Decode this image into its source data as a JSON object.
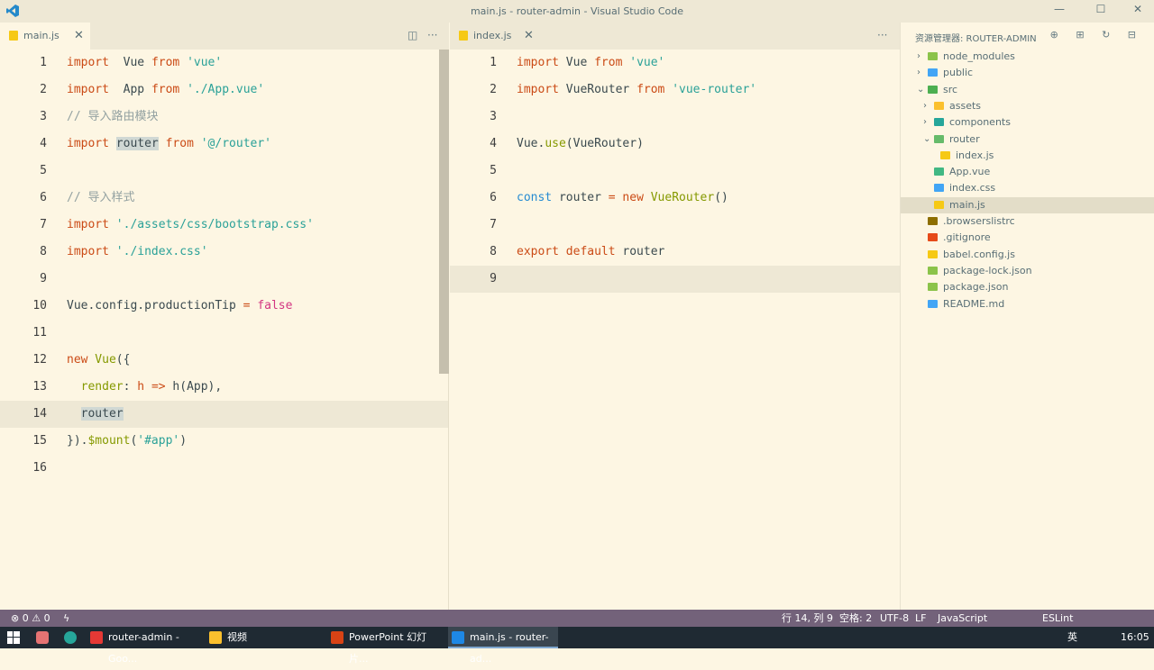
{
  "window": {
    "title": "main.js - router-admin - Visual Studio Code",
    "minimize": "—",
    "maximize": "☐",
    "close": "✕"
  },
  "left_tab": {
    "label": "main.js"
  },
  "right_tab": {
    "label": "index.js"
  },
  "left_code": [
    {
      "n": "1",
      "t": [
        [
          "kw",
          "import"
        ],
        [
          "",
          "  Vue "
        ],
        [
          "kw",
          "from"
        ],
        [
          "str",
          " 'vue'"
        ]
      ]
    },
    {
      "n": "2",
      "t": [
        [
          "kw",
          "import"
        ],
        [
          "",
          "  App "
        ],
        [
          "kw",
          "from"
        ],
        [
          "str",
          " './App.vue'"
        ]
      ]
    },
    {
      "n": "3",
      "t": [
        [
          "cmt",
          "// 导入路由模块"
        ]
      ]
    },
    {
      "n": "4",
      "t": [
        [
          "kw",
          "import"
        ],
        [
          "",
          " "
        ],
        [
          "sel",
          "router"
        ],
        [
          "",
          " "
        ],
        [
          "kw",
          "from"
        ],
        [
          "str",
          " '@/router'"
        ]
      ]
    },
    {
      "n": "5",
      "t": []
    },
    {
      "n": "6",
      "t": [
        [
          "cmt",
          "// 导入样式"
        ]
      ]
    },
    {
      "n": "7",
      "t": [
        [
          "kw",
          "import"
        ],
        [
          "str",
          " './assets/css/bootstrap.css'"
        ]
      ]
    },
    {
      "n": "8",
      "t": [
        [
          "kw",
          "import"
        ],
        [
          "str",
          " './index.css'"
        ]
      ]
    },
    {
      "n": "9",
      "t": []
    },
    {
      "n": "10",
      "t": [
        [
          "",
          "Vue.config.productionTip "
        ],
        [
          "kw",
          "="
        ],
        [
          "bool",
          " false"
        ]
      ]
    },
    {
      "n": "11",
      "t": []
    },
    {
      "n": "12",
      "t": [
        [
          "kw",
          "new"
        ],
        [
          "cls",
          " Vue"
        ],
        [
          "",
          "({"
        ]
      ]
    },
    {
      "n": "13",
      "t": [
        [
          "",
          "  "
        ],
        [
          "cls",
          "render"
        ],
        [
          "",
          ": "
        ],
        [
          "kw",
          "h"
        ],
        [
          "",
          " "
        ],
        [
          "kw",
          "=>"
        ],
        [
          "",
          " h(App),"
        ]
      ]
    },
    {
      "n": "14",
      "t": [
        [
          "",
          "  "
        ],
        [
          "sel",
          "router"
        ]
      ]
    },
    {
      "n": "15",
      "t": [
        [
          "",
          "})."
        ],
        [
          "cls",
          "$mount"
        ],
        [
          "",
          "("
        ],
        [
          "str",
          "'#app'"
        ],
        [
          "",
          ")"
        ]
      ]
    },
    {
      "n": "16",
      "t": []
    }
  ],
  "right_code": [
    {
      "n": "1",
      "t": [
        [
          "kw",
          "import"
        ],
        [
          "",
          " Vue "
        ],
        [
          "kw",
          "from"
        ],
        [
          "str",
          " 'vue'"
        ]
      ]
    },
    {
      "n": "2",
      "t": [
        [
          "kw",
          "import"
        ],
        [
          "",
          " VueRouter "
        ],
        [
          "kw",
          "from"
        ],
        [
          "str",
          " 'vue-router'"
        ]
      ]
    },
    {
      "n": "3",
      "t": []
    },
    {
      "n": "4",
      "t": [
        [
          "",
          "Vue."
        ],
        [
          "cls",
          "use"
        ],
        [
          "",
          "(VueRouter)"
        ]
      ]
    },
    {
      "n": "5",
      "t": []
    },
    {
      "n": "6",
      "t": [
        [
          "fn",
          "const"
        ],
        [
          "",
          " router "
        ],
        [
          "kw",
          "="
        ],
        [
          "kw",
          " new"
        ],
        [
          "cls",
          " VueRouter"
        ],
        [
          "",
          "()"
        ]
      ]
    },
    {
      "n": "7",
      "t": []
    },
    {
      "n": "8",
      "t": [
        [
          "kw",
          "export default"
        ],
        [
          "",
          " router"
        ]
      ]
    },
    {
      "n": "9",
      "t": []
    }
  ],
  "explorer": {
    "header": "资源管理器: ROUTER-ADMIN",
    "actions": "⊕ ⊞ ↻ ⊟",
    "items": [
      {
        "label": "node_modules",
        "depth": 0,
        "chev": "›",
        "icon": "#8bc34a"
      },
      {
        "label": "public",
        "depth": 0,
        "chev": "›",
        "icon": "#42a5f5"
      },
      {
        "label": "src",
        "depth": 0,
        "chev": "⌄",
        "icon": "#4caf50"
      },
      {
        "label": "assets",
        "depth": 1,
        "chev": "›",
        "icon": "#fbc02d"
      },
      {
        "label": "components",
        "depth": 1,
        "chev": "›",
        "icon": "#26a69a"
      },
      {
        "label": "router",
        "depth": 1,
        "chev": "⌄",
        "icon": "#66bb6a"
      },
      {
        "label": "index.js",
        "depth": 2,
        "chev": "",
        "icon": "#f6c915"
      },
      {
        "label": "App.vue",
        "depth": 1,
        "chev": "",
        "icon": "#41b883"
      },
      {
        "label": "index.css",
        "depth": 1,
        "chev": "",
        "icon": "#42a5f5"
      },
      {
        "label": "main.js",
        "depth": 1,
        "chev": "",
        "icon": "#f6c915"
      },
      {
        "label": ".browserslistrc",
        "depth": 0,
        "chev": "",
        "icon": "#8d6e00"
      },
      {
        "label": ".gitignore",
        "depth": 0,
        "chev": "",
        "icon": "#e64a19"
      },
      {
        "label": "babel.config.js",
        "depth": 0,
        "chev": "",
        "icon": "#f6c915"
      },
      {
        "label": "package-lock.json",
        "depth": 0,
        "chev": "",
        "icon": "#8bc34a"
      },
      {
        "label": "package.json",
        "depth": 0,
        "chev": "",
        "icon": "#8bc34a"
      },
      {
        "label": "README.md",
        "depth": 0,
        "chev": "",
        "icon": "#42a5f5"
      }
    ]
  },
  "status": {
    "errors": "⊗ 0 ⚠ 0",
    "bolt": "ϟ",
    "position": "行 14, 列 9",
    "spaces": "空格: 2",
    "encoding": "UTF-8",
    "eol": "LF",
    "lang": "JavaScript",
    "lint": "ESLint"
  },
  "taskbar": {
    "items": [
      {
        "label": "router-admin - Goo...",
        "color": "#e53935"
      },
      {
        "label": "视频",
        "color": "#fbc02d"
      },
      {
        "label": "PowerPoint 幻灯片...",
        "color": "#d84315"
      },
      {
        "label": "main.js - router-ad...",
        "color": "#1e88e5"
      }
    ],
    "ime": "英",
    "time": "16:05"
  }
}
